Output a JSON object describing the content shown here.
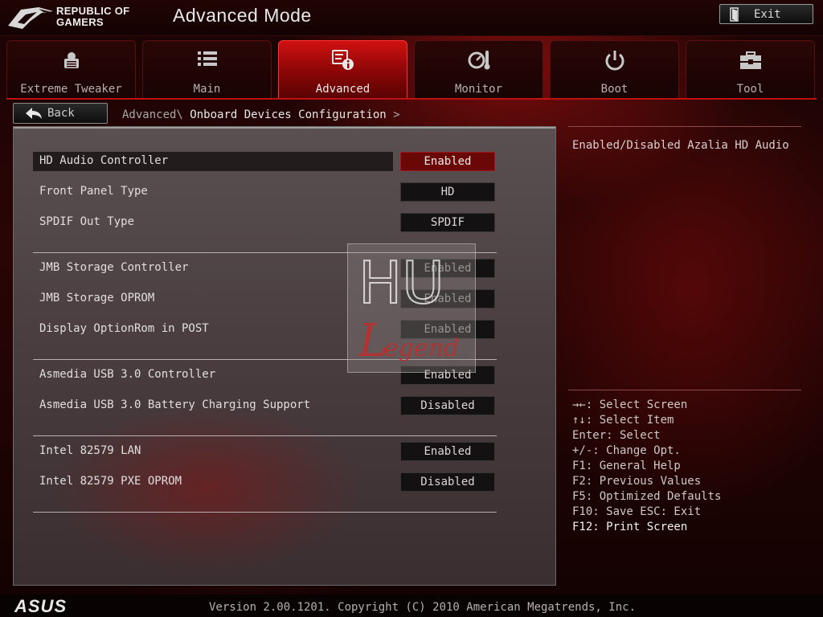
{
  "header": {
    "brand_line1": "REPUBLIC OF",
    "brand_line2": "GAMERS",
    "title": "Advanced Mode",
    "exit_label": "Exit"
  },
  "tabs": [
    {
      "label": "Extreme Tweaker",
      "icon": "extreme-tweaker-icon",
      "active": false
    },
    {
      "label": "Main",
      "icon": "list-icon",
      "active": false
    },
    {
      "label": "Advanced",
      "icon": "advanced-info-icon",
      "active": true
    },
    {
      "label": "Monitor",
      "icon": "monitor-gauge-icon",
      "active": false
    },
    {
      "label": "Boot",
      "icon": "power-icon",
      "active": false
    },
    {
      "label": "Tool",
      "icon": "toolbox-icon",
      "active": false
    }
  ],
  "nav": {
    "back_label": "Back",
    "breadcrumb_parent": "Advanced\\",
    "breadcrumb_current": "Onboard Devices Configuration",
    "breadcrumb_arrow": ">"
  },
  "settings": [
    {
      "label": "HD Audio Controller",
      "value": "Enabled",
      "selected": true
    },
    {
      "label": "Front Panel Type",
      "value": "HD"
    },
    {
      "label": "SPDIF Out Type",
      "value": "SPDIF"
    },
    {
      "label": "JMB Storage Controller",
      "value": "Enabled"
    },
    {
      "label": "JMB Storage OPROM",
      "value": "Enabled"
    },
    {
      "label": "Display OptionRom in POST",
      "value": "Enabled"
    },
    {
      "label": "Asmedia USB 3.0 Controller",
      "value": "Enabled"
    },
    {
      "label": "Asmedia USB 3.0 Battery Charging Support",
      "value": "Disabled"
    },
    {
      "label": "Intel 82579 LAN",
      "value": "Enabled"
    },
    {
      "label": "Intel 82579 PXE OPROM",
      "value": "Disabled"
    }
  ],
  "watermark": {
    "top": "HU",
    "bottom": "egend",
    "initial": "L"
  },
  "help": {
    "description": "Enabled/Disabled Azalia HD Audio",
    "keys": [
      "→←: Select Screen",
      "↑↓: Select Item",
      "Enter: Select",
      "+/-: Change Opt.",
      "F1: General Help",
      "F2: Previous Values",
      "F5: Optimized Defaults",
      "F10: Save  ESC: Exit",
      "F12: Print Screen"
    ]
  },
  "footer": {
    "logo_text": "ASUS",
    "version": "Version 2.00.1201. Copyright (C) 2010 American Megatrends, Inc."
  },
  "colors": {
    "accent": "#c01010",
    "selected_value": "#6a0808"
  }
}
